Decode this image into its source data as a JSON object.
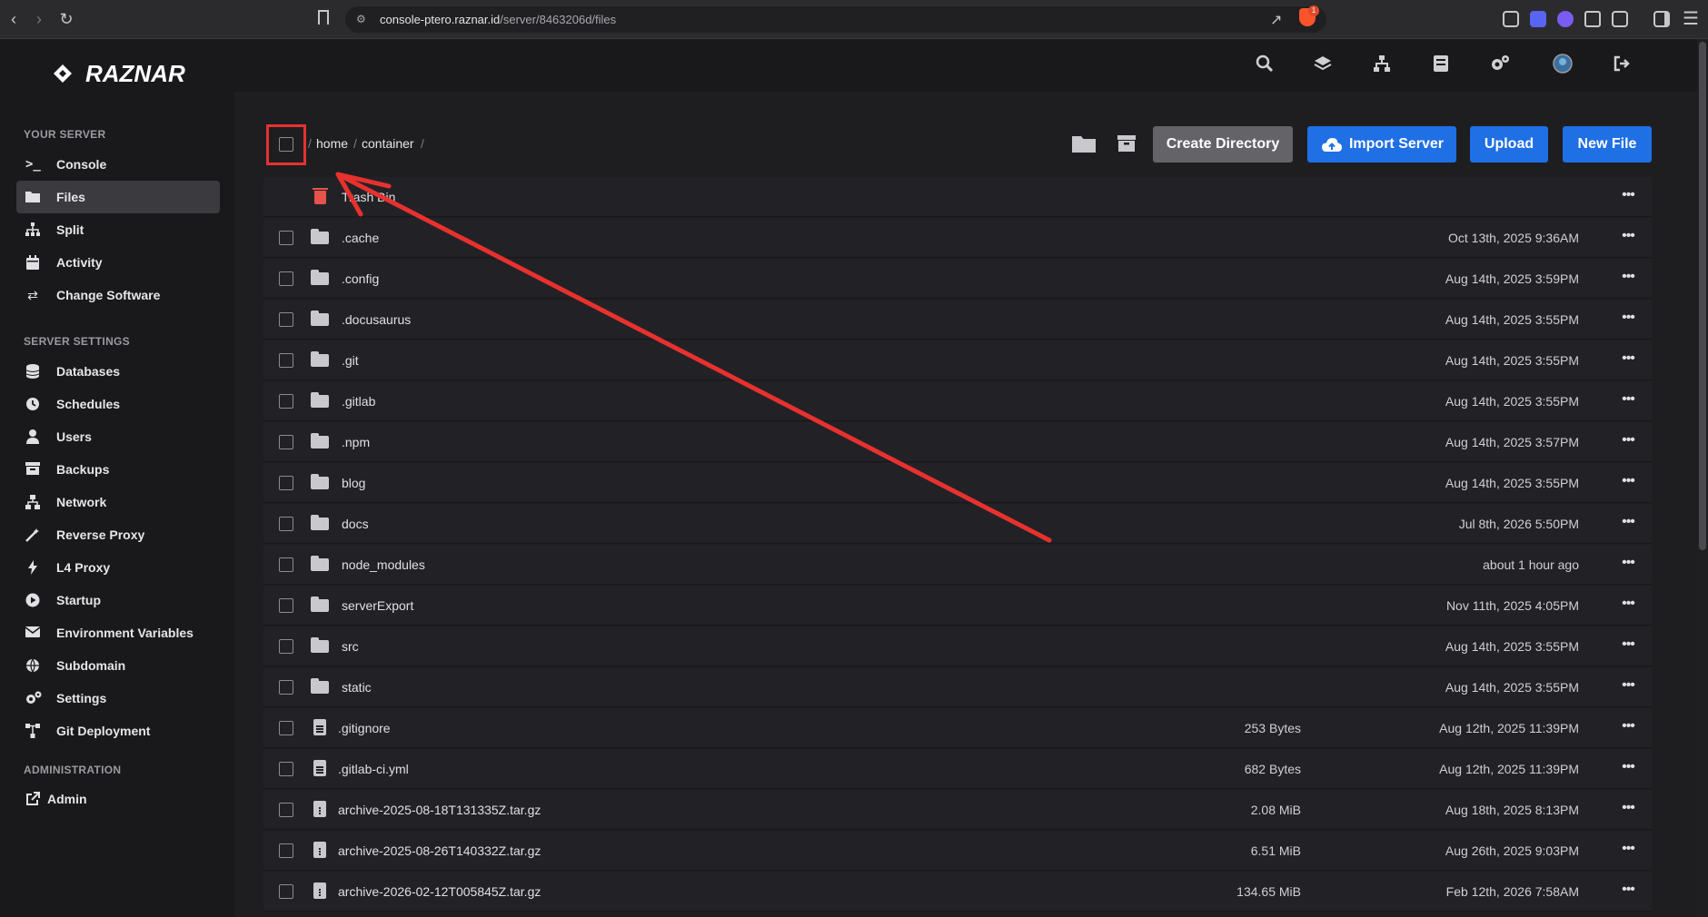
{
  "browser": {
    "url_host": "console-ptero.raznar.id",
    "url_path": "/server/8463206d/files",
    "brave_badge": "1"
  },
  "app": {
    "logo_text": "RAZNAR"
  },
  "header_icons": [
    "search-icon",
    "layers-icon",
    "sitemap-icon",
    "server-icon",
    "cogs-icon",
    "avatar",
    "logout-icon"
  ],
  "sidebar": {
    "your_server_title": "YOUR SERVER",
    "server_settings_title": "SERVER SETTINGS",
    "administration_title": "ADMINISTRATION",
    "server_items": [
      {
        "label": "Console",
        "icon": "terminal-icon"
      },
      {
        "label": "Files",
        "icon": "folder-icon",
        "active": true
      },
      {
        "label": "Split",
        "icon": "sitemap-icon"
      },
      {
        "label": "Activity",
        "icon": "calendar-icon"
      },
      {
        "label": "Change Software",
        "icon": "exchange-icon"
      }
    ],
    "settings_items": [
      {
        "label": "Databases",
        "icon": "database-icon"
      },
      {
        "label": "Schedules",
        "icon": "clock-icon"
      },
      {
        "label": "Users",
        "icon": "user-icon"
      },
      {
        "label": "Backups",
        "icon": "archive-icon"
      },
      {
        "label": "Network",
        "icon": "network-icon"
      },
      {
        "label": "Reverse Proxy",
        "icon": "wand-icon"
      },
      {
        "label": "L4 Proxy",
        "icon": "bolt-icon"
      },
      {
        "label": "Startup",
        "icon": "play-icon"
      },
      {
        "label": "Environment Variables",
        "icon": "envelope-icon"
      },
      {
        "label": "Subdomain",
        "icon": "globe-icon"
      },
      {
        "label": "Settings",
        "icon": "cogs-icon"
      },
      {
        "label": "Git Deployment",
        "icon": "git-icon"
      }
    ],
    "admin_items": [
      {
        "label": "Admin",
        "icon": "external-link-icon"
      }
    ]
  },
  "breadcrumb": {
    "sep": "/",
    "home": "home",
    "container": "container"
  },
  "toolbar": {
    "create_directory": "Create Directory",
    "import_server": "Import Server",
    "upload": "Upload",
    "new_file": "New File"
  },
  "files": [
    {
      "name": "Trash Bin",
      "type": "trash",
      "size": "",
      "date": ""
    },
    {
      "name": ".cache",
      "type": "folder",
      "size": "",
      "date": "Oct 13th, 2025 9:36AM"
    },
    {
      "name": ".config",
      "type": "folder",
      "size": "",
      "date": "Aug 14th, 2025 3:59PM"
    },
    {
      "name": ".docusaurus",
      "type": "folder",
      "size": "",
      "date": "Aug 14th, 2025 3:55PM"
    },
    {
      "name": ".git",
      "type": "folder",
      "size": "",
      "date": "Aug 14th, 2025 3:55PM"
    },
    {
      "name": ".gitlab",
      "type": "folder",
      "size": "",
      "date": "Aug 14th, 2025 3:55PM"
    },
    {
      "name": ".npm",
      "type": "folder",
      "size": "",
      "date": "Aug 14th, 2025 3:57PM"
    },
    {
      "name": "blog",
      "type": "folder",
      "size": "",
      "date": "Aug 14th, 2025 3:55PM"
    },
    {
      "name": "docs",
      "type": "folder",
      "size": "",
      "date": "Jul 8th, 2026 5:50PM"
    },
    {
      "name": "node_modules",
      "type": "folder",
      "size": "",
      "date": "about 1 hour ago"
    },
    {
      "name": "serverExport",
      "type": "folder",
      "size": "",
      "date": "Nov 11th, 2025 4:05PM"
    },
    {
      "name": "src",
      "type": "folder",
      "size": "",
      "date": "Aug 14th, 2025 3:55PM"
    },
    {
      "name": "static",
      "type": "folder",
      "size": "",
      "date": "Aug 14th, 2025 3:55PM"
    },
    {
      "name": ".gitignore",
      "type": "file",
      "size": "253 Bytes",
      "date": "Aug 12th, 2025 11:39PM"
    },
    {
      "name": ".gitlab-ci.yml",
      "type": "file",
      "size": "682 Bytes",
      "date": "Aug 12th, 2025 11:39PM"
    },
    {
      "name": "archive-2025-08-18T131335Z.tar.gz",
      "type": "archive",
      "size": "2.08 MiB",
      "date": "Aug 18th, 2025 8:13PM"
    },
    {
      "name": "archive-2025-08-26T140332Z.tar.gz",
      "type": "archive",
      "size": "6.51 MiB",
      "date": "Aug 26th, 2025 9:03PM"
    },
    {
      "name": "archive-2026-02-12T005845Z.tar.gz",
      "type": "archive",
      "size": "134.65 MiB",
      "date": "Feb 12th, 2026 7:58AM"
    }
  ],
  "more_label": "•••",
  "colors": {
    "accent_blue": "#1f6fe5",
    "annotation_red": "#e8312f",
    "trash_red": "#e5534b"
  }
}
